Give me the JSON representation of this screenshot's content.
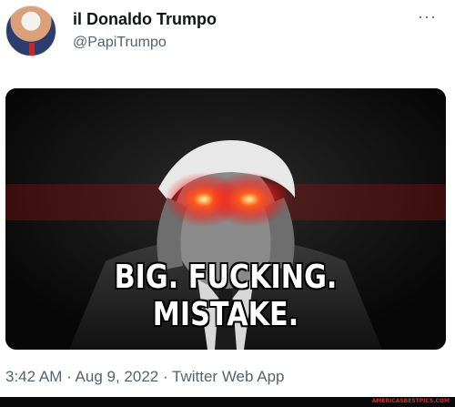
{
  "tweet": {
    "display_name": "il Donaldo Trumpo",
    "handle": "@PapiTrumpo",
    "more_label": "···",
    "avatar_icon": "profile-avatar",
    "media": {
      "caption": "BIG. FUCKING. MISTAKE.",
      "eye_glow_color": "#ff2a1a",
      "background_color": "#0b0b0b"
    },
    "meta": "3:42 AM · Aug 9, 2022 · Twitter Web App"
  },
  "watermark": "AMERICASBESTPICS.COM"
}
